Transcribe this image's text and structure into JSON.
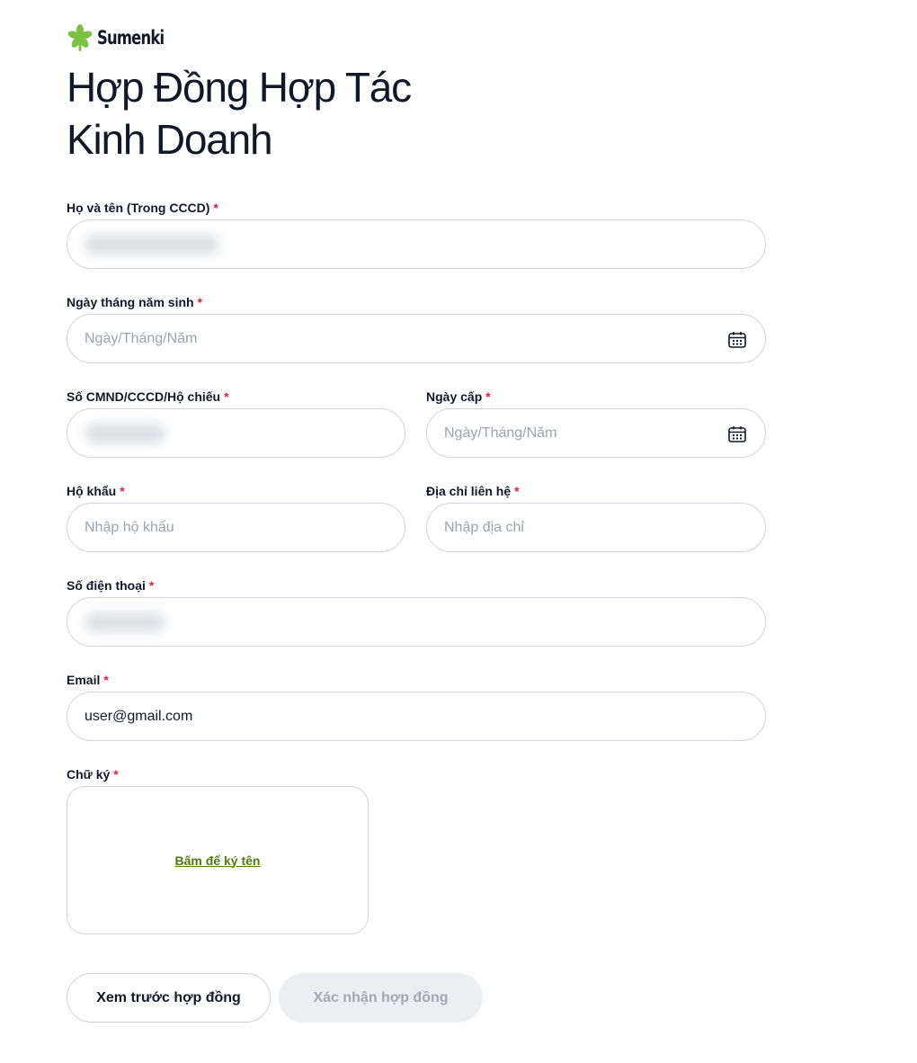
{
  "brand": {
    "name": "Sumenki",
    "icon": "flower-logo-icon",
    "color": "#7cc242"
  },
  "page": {
    "title_line1": "Hợp Đồng Hợp Tác",
    "title_line2": "Kinh Doanh"
  },
  "form": {
    "required_mark": "*",
    "full_name": {
      "label": "Họ và tên (Trong CCCD)",
      "value": ""
    },
    "dob": {
      "label": "Ngày tháng năm sinh",
      "placeholder": "Ngày/Tháng/Năm",
      "icon": "calendar-icon"
    },
    "id_number": {
      "label": "Số CMND/CCCD/Hộ chiếu",
      "value": ""
    },
    "issue_date": {
      "label": "Ngày cấp",
      "placeholder": "Ngày/Tháng/Năm",
      "icon": "calendar-icon"
    },
    "household": {
      "label": "Hộ khẩu",
      "placeholder": "Nhập hộ khẩu"
    },
    "address": {
      "label": "Địa chỉ liên hệ",
      "placeholder": "Nhập địa chỉ"
    },
    "phone": {
      "label": "Số điện thoại",
      "value": ""
    },
    "email": {
      "label": "Email",
      "value": "user@gmail.com"
    },
    "signature": {
      "label": "Chữ ký",
      "link": "Bấm để ký tên"
    }
  },
  "actions": {
    "preview_label": "Xem trước hợp đồng",
    "confirm_label": "Xác nhận hợp đồng"
  },
  "colors": {
    "required": "#e11d48",
    "link": "#4d7c0f",
    "disabled_bg": "#eceef1"
  }
}
